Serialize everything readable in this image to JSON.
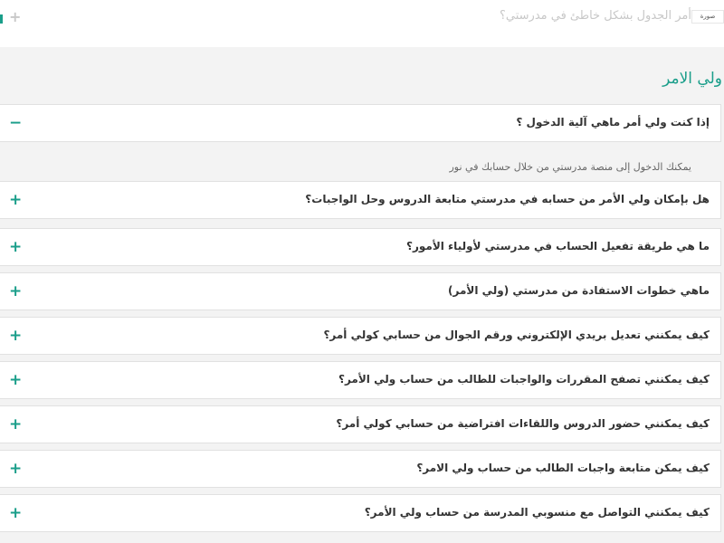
{
  "top": {
    "question": "أمر الجدول بشكل خاطئ في مدرستي؟",
    "badge": "صورة بحجم"
  },
  "section": {
    "title": "ولي الامر"
  },
  "faq": [
    {
      "question": "إذا كنت ولي أمر ماهي آلية الدخول ؟",
      "toggle": "−",
      "expanded": true,
      "answer": "يمكنك الدخول إلى منصة مدرستي من خلال حسابك في نور"
    },
    {
      "question": "هل بإمكان ولي الأمر من حسابه في مدرستي متابعة الدروس وحل الواجبات؟",
      "toggle": "+"
    },
    {
      "question": "ما هي طريقة تفعيل الحساب في مدرستي لأولياء الأمور؟",
      "toggle": "+"
    },
    {
      "question": "ماهي خطوات الاستفادة من مدرستي (ولي الأمر)",
      "toggle": "+"
    },
    {
      "question": "كيف يمكنني تعديل بريدي الإلكتروني ورقم الجوال من حسابي كولي أمر؟",
      "toggle": "+"
    },
    {
      "question": "كيف يمكنني تصفح المقررات والواجبات للطالب من حساب ولي الأمر؟",
      "toggle": "+"
    },
    {
      "question": "كيف يمكنني حضور الدروس واللقاءات افتراضية من حسابي كولي أمر؟",
      "toggle": "+"
    },
    {
      "question": "كيف يمكن متابعة واجبات الطالب من حساب ولي الامر؟",
      "toggle": "+"
    },
    {
      "question": "كيف يمكنني التواصل مع منسوبي المدرسة من حساب ولي الأمر؟",
      "toggle": "+"
    }
  ]
}
